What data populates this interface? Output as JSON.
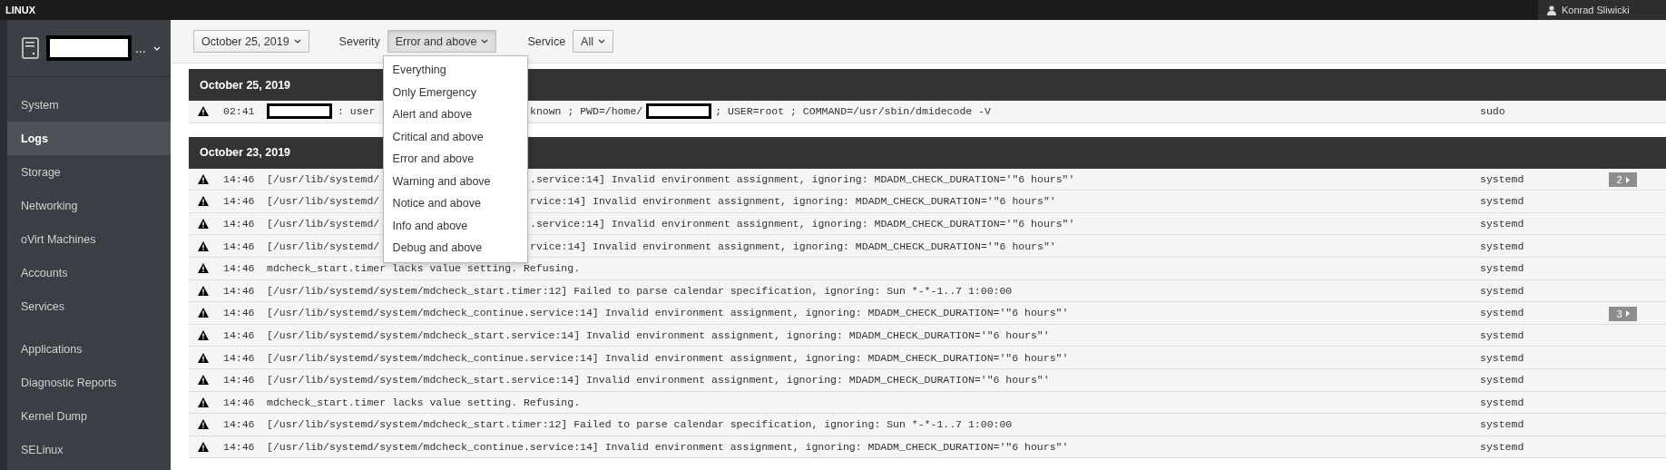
{
  "top_bar": {
    "title": "LINUX",
    "user": "Konrad Sliwicki"
  },
  "sidebar": {
    "host": {
      "redacted": true,
      "ellipsis": "..."
    },
    "items": [
      {
        "label": "System",
        "selected": false,
        "kind": "item"
      },
      {
        "label": "Logs",
        "selected": true,
        "kind": "item"
      },
      {
        "label": "Storage",
        "selected": false,
        "kind": "item"
      },
      {
        "label": "Networking",
        "selected": false,
        "kind": "item"
      },
      {
        "label": "oVirt Machines",
        "selected": false,
        "kind": "item"
      },
      {
        "label": "Accounts",
        "selected": false,
        "kind": "item"
      },
      {
        "label": "Services",
        "selected": false,
        "kind": "item"
      },
      {
        "label": "Applications",
        "selected": false,
        "kind": "group-start"
      },
      {
        "label": "Diagnostic Reports",
        "selected": false,
        "kind": "item"
      },
      {
        "label": "Kernel Dump",
        "selected": false,
        "kind": "item"
      },
      {
        "label": "SELinux",
        "selected": false,
        "kind": "item"
      }
    ]
  },
  "filters": {
    "date": "October 25, 2019",
    "severity_label": "Severity",
    "severity": "Error and above",
    "severity_open": true,
    "service_label": "Service",
    "service": "All"
  },
  "severity_menu": [
    "Everything",
    "Only Emergency",
    "Alert and above",
    "Critical and above",
    "Error and above",
    "Warning and above",
    "Notice and above",
    "Info and above",
    "Debug and above"
  ],
  "log_groups": [
    {
      "date": "October 25, 2019",
      "rows": [
        {
          "time": "02:41",
          "before": [
            {
              "kind": "redaction"
            },
            {
              "kind": "text",
              "text": ": user"
            }
          ],
          "after": [
            {
              "kind": "text",
              "text": "known ; PWD=/home/"
            },
            {
              "kind": "redaction"
            },
            {
              "kind": "text",
              "text": "; USER=root ; COMMAND=/usr/sbin/dmidecode -V"
            }
          ],
          "service": "sudo"
        }
      ]
    },
    {
      "date": "October 23, 2019",
      "rows": [
        {
          "time": "14:46",
          "before": [
            {
              "kind": "text",
              "text": "[/usr/lib/systemd/"
            }
          ],
          "after": [
            {
              "kind": "text",
              "text": ".service:14] Invalid environment assignment, ignoring: MDADM_CHECK_DURATION='\"6 hours\"'"
            }
          ],
          "service": "systemd",
          "badge": "2"
        },
        {
          "time": "14:46",
          "before": [
            {
              "kind": "text",
              "text": "[/usr/lib/systemd/"
            }
          ],
          "after": [
            {
              "kind": "text",
              "text": "rvice:14] Invalid environment assignment, ignoring: MDADM_CHECK_DURATION='\"6 hours\"'"
            }
          ],
          "service": "systemd"
        },
        {
          "time": "14:46",
          "before": [
            {
              "kind": "text",
              "text": "[/usr/lib/systemd/"
            }
          ],
          "after": [
            {
              "kind": "text",
              "text": ".service:14] Invalid environment assignment, ignoring: MDADM_CHECK_DURATION='\"6 hours\"'"
            }
          ],
          "service": "systemd"
        },
        {
          "time": "14:46",
          "before": [
            {
              "kind": "text",
              "text": "[/usr/lib/systemd/"
            }
          ],
          "after": [
            {
              "kind": "text",
              "text": "rvice:14] Invalid environment assignment, ignoring: MDADM_CHECK_DURATION='\"6 hours\"'"
            }
          ],
          "service": "systemd"
        },
        {
          "time": "14:46",
          "message": "mdcheck_start.timer lacks value setting. Refusing.",
          "service": "systemd"
        },
        {
          "time": "14:46",
          "message": "[/usr/lib/systemd/system/mdcheck_start.timer:12] Failed to parse calendar specification, ignoring: Sun *-*-1..7 1:00:00",
          "service": "systemd"
        },
        {
          "time": "14:46",
          "message": "[/usr/lib/systemd/system/mdcheck_continue.service:14] Invalid environment assignment, ignoring: MDADM_CHECK_DURATION='\"6 hours\"'",
          "service": "systemd",
          "badge": "3"
        },
        {
          "time": "14:46",
          "message": "[/usr/lib/systemd/system/mdcheck_start.service:14] Invalid environment assignment, ignoring: MDADM_CHECK_DURATION='\"6 hours\"'",
          "service": "systemd"
        },
        {
          "time": "14:46",
          "message": "[/usr/lib/systemd/system/mdcheck_continue.service:14] Invalid environment assignment, ignoring: MDADM_CHECK_DURATION='\"6 hours\"'",
          "service": "systemd"
        },
        {
          "time": "14:46",
          "message": "[/usr/lib/systemd/system/mdcheck_start.service:14] Invalid environment assignment, ignoring: MDADM_CHECK_DURATION='\"6 hours\"'",
          "service": "systemd"
        },
        {
          "time": "14:46",
          "message": "mdcheck_start.timer lacks value setting. Refusing.",
          "service": "systemd"
        },
        {
          "time": "14:46",
          "message": "[/usr/lib/systemd/system/mdcheck_start.timer:12] Failed to parse calendar specification, ignoring: Sun *-*-1..7 1:00:00",
          "service": "systemd"
        },
        {
          "time": "14:46",
          "message": "[/usr/lib/systemd/system/mdcheck_continue.service:14] Invalid environment assignment, ignoring: MDADM_CHECK_DURATION='\"6 hours\"'",
          "service": "systemd"
        }
      ]
    }
  ]
}
